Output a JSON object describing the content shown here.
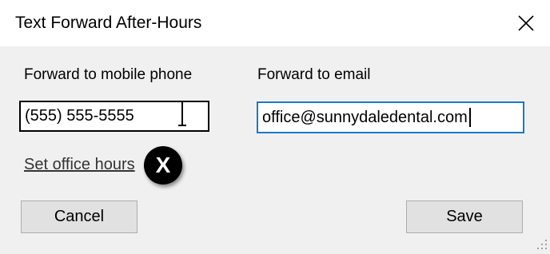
{
  "window": {
    "title": "Text Forward After-Hours",
    "close_icon": "close-icon"
  },
  "form": {
    "mobile_label": "Forward to mobile phone",
    "mobile_value": "(555) 555-5555",
    "email_label": "Forward to email",
    "email_value": "office@sunnydaledental.com",
    "email_focus_color": "#1979ca"
  },
  "links": {
    "office_hours": "Set office hours"
  },
  "badge": {
    "text": "X"
  },
  "buttons": {
    "cancel": "Cancel",
    "save": "Save"
  }
}
